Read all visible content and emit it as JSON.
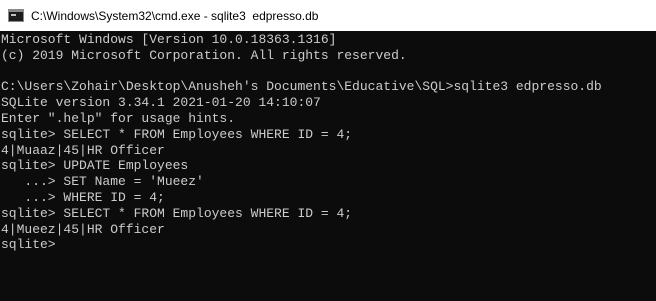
{
  "window": {
    "title": "C:\\Windows\\System32\\cmd.exe - sqlite3  edpresso.db",
    "icon": "cmd-icon"
  },
  "console": {
    "lines": [
      "Microsoft Windows [Version 10.0.18363.1316]",
      "(c) 2019 Microsoft Corporation. All rights reserved.",
      "",
      "C:\\Users\\Zohair\\Desktop\\Anusheh's Documents\\Educative\\SQL>sqlite3 edpresso.db",
      "SQLite version 3.34.1 2021-01-20 14:10:07",
      "Enter \".help\" for usage hints.",
      "sqlite> SELECT * FROM Employees WHERE ID = 4;",
      "4|Muaaz|45|HR Officer",
      "sqlite> UPDATE Employees",
      "   ...> SET Name = 'Mueez'",
      "   ...> WHERE ID = 4;",
      "sqlite> SELECT * FROM Employees WHERE ID = 4;",
      "4|Mueez|45|HR Officer",
      "sqlite> "
    ]
  },
  "colors": {
    "console_bg": "#0c0c0c",
    "console_fg": "#cccccc",
    "titlebar_bg": "#ffffff"
  }
}
